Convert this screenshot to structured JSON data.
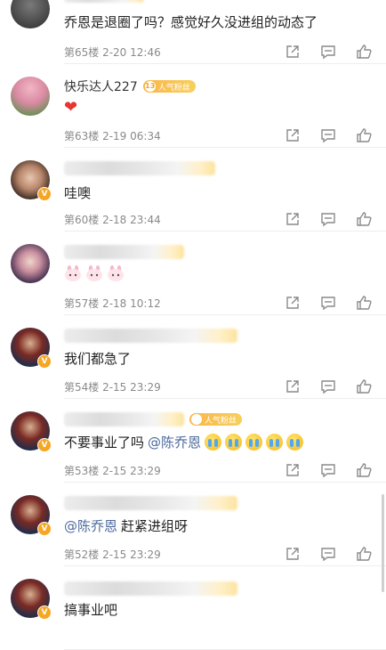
{
  "comments": [
    {
      "floor_time": "第65楼  2-20 12:46",
      "text": "乔恩是退圈了吗？感觉好久没进组的动态了"
    },
    {
      "name": "快乐达人227",
      "fan_badge": {
        "level": "13",
        "label": "人气粉丝"
      },
      "floor_time": "第63楼  2-19 06:34",
      "emoji": "heart"
    },
    {
      "floor_time": "第60楼  2-18 23:44",
      "text": "哇噢"
    },
    {
      "floor_time": "第57楼  2-18 10:12",
      "emoji": "rabbit x3"
    },
    {
      "floor_time": "第54楼  2-15 23:29",
      "text": "我们都急了"
    },
    {
      "fan_badge": {
        "label": "人气粉丝"
      },
      "floor_time": "第53楼  2-15 23:29",
      "text": "不要事业了吗",
      "mention": "@陈乔恩",
      "emoji": "crying x5"
    },
    {
      "floor_time": "第52楼  2-15 23:29",
      "mention": "@陈乔恩",
      "text": "赶紧进组呀"
    },
    {
      "text": "搞事业吧"
    }
  ],
  "badge_v": "V",
  "colors": {
    "mention": "#4c6a9c",
    "badge": "#f6a623",
    "meta": "#8a8a8a"
  }
}
